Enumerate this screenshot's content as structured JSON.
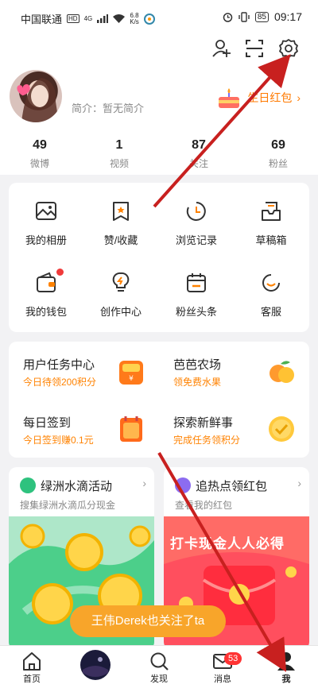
{
  "status_bar": {
    "carrier": "中国联通",
    "network": "HD",
    "signal_gen": "4G",
    "speed_value": "6.8",
    "speed_unit": "K/s",
    "battery": "85",
    "time": "09:17"
  },
  "profile": {
    "intro": "简介：暂无简介",
    "birthday_label": "生日红包",
    "stats": [
      {
        "value": "49",
        "label": "微博"
      },
      {
        "value": "1",
        "label": "视频"
      },
      {
        "value": "87",
        "label": "关注"
      },
      {
        "value": "69",
        "label": "粉丝"
      }
    ]
  },
  "grid": [
    {
      "label": "我的相册",
      "icon": "photo-album-icon"
    },
    {
      "label": "赞/收藏",
      "icon": "favorites-icon"
    },
    {
      "label": "浏览记录",
      "icon": "history-icon"
    },
    {
      "label": "草稿箱",
      "icon": "drafts-icon"
    },
    {
      "label": "我的钱包",
      "icon": "wallet-icon"
    },
    {
      "label": "创作中心",
      "icon": "creator-center-icon"
    },
    {
      "label": "粉丝头条",
      "icon": "fans-headline-icon"
    },
    {
      "label": "客服",
      "icon": "customer-service-icon"
    }
  ],
  "tasks": [
    {
      "title": "用户任务中心",
      "subtitle": "今日待领200积分",
      "icon": "task-bag-icon"
    },
    {
      "title": "芭芭农场",
      "subtitle": "领免费水果",
      "icon": "fruit-icon"
    },
    {
      "title": "每日签到",
      "subtitle": "今日签到赚0.1元",
      "icon": "checkin-icon"
    },
    {
      "title": "探索新鲜事",
      "subtitle": "完成任务领积分",
      "icon": "check-coin-icon"
    }
  ],
  "promos": [
    {
      "title": "绿洲水滴活动",
      "subtitle": "搜集绿洲水滴瓜分现金"
    },
    {
      "title": "追热点领红包",
      "subtitle": "查看我的红包",
      "banner": "打卡现金人人必得"
    }
  ],
  "toast": "王伟Derek也关注了ta",
  "nav": {
    "items": [
      {
        "label": "首页"
      },
      {
        "label": ""
      },
      {
        "label": "发现"
      },
      {
        "label": "消息"
      },
      {
        "label": "我"
      }
    ],
    "message_badge": "53"
  },
  "colors": {
    "accent": "#ff8200",
    "annotation_arrow": "#c8201f",
    "toast": "#f8a52a"
  }
}
